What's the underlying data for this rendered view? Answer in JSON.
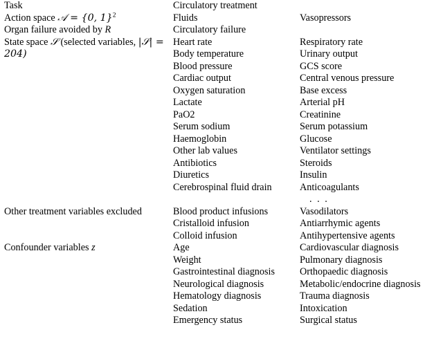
{
  "table": {
    "rows": [
      {
        "id": "task",
        "label": "Task",
        "label_math": null,
        "col_a": [
          "Circulatory treatment"
        ],
        "col_b": []
      },
      {
        "id": "action-space",
        "label": "Action space",
        "label_math": "𝒜 = {0, 1}",
        "label_math_sup": "2",
        "col_a": [
          "Fluids"
        ],
        "col_b": [
          "Vasopressors"
        ]
      },
      {
        "id": "organ-failure",
        "label": "Organ failure avoided by",
        "label_math": "R",
        "col_a": [
          "Circulatory failure"
        ],
        "col_b": []
      },
      {
        "id": "state-space",
        "label_part1": "State space",
        "label_math1": "𝒮",
        "label_part2": "(selected variables,",
        "label_math2": "|𝒮| = 204)",
        "col_a": [
          "Heart rate",
          "Body temperature",
          "Blood pressure",
          "Cardiac output",
          "Oxygen saturation",
          "Lactate",
          "PaO2",
          "Serum sodium",
          "Haemoglobin",
          "Other lab values",
          "Antibiotics",
          "Diuretics",
          "Cerebrospinal fluid drain"
        ],
        "col_b": [
          "Respiratory rate",
          "Urinary output",
          "GCS score",
          "Central venous pressure",
          "Base excess",
          "Arterial pH",
          "Creatinine",
          "Serum potassium",
          "Glucose",
          "Ventilator settings",
          "Steroids",
          "Insulin",
          "Anticoagulants"
        ],
        "col_b_ellipsis": ". . ."
      },
      {
        "id": "excluded-treatments",
        "label": "Other treatment variables excluded",
        "col_a": [
          "Blood product infusions",
          "Cristalloid infusion",
          "Colloid infusion"
        ],
        "col_b": [
          "Vasodilators",
          "Antiarrhymic agents",
          "Antihypertensive agents"
        ]
      },
      {
        "id": "confounders",
        "label": "Confounder variables",
        "label_math": "z",
        "col_a": [
          "Age",
          "Weight",
          "Gastrointestinal diagnosis",
          "Neurological diagnosis",
          "Hematology diagnosis",
          "Sedation",
          "Emergency status"
        ],
        "col_b": [
          "Cardiovascular diagnosis",
          "Pulmonary diagnosis",
          "Orthopaedic diagnosis",
          "Metabolic/endocrine diagnosis",
          "Trauma diagnosis",
          "Intoxication",
          "Surgical status"
        ]
      }
    ]
  }
}
